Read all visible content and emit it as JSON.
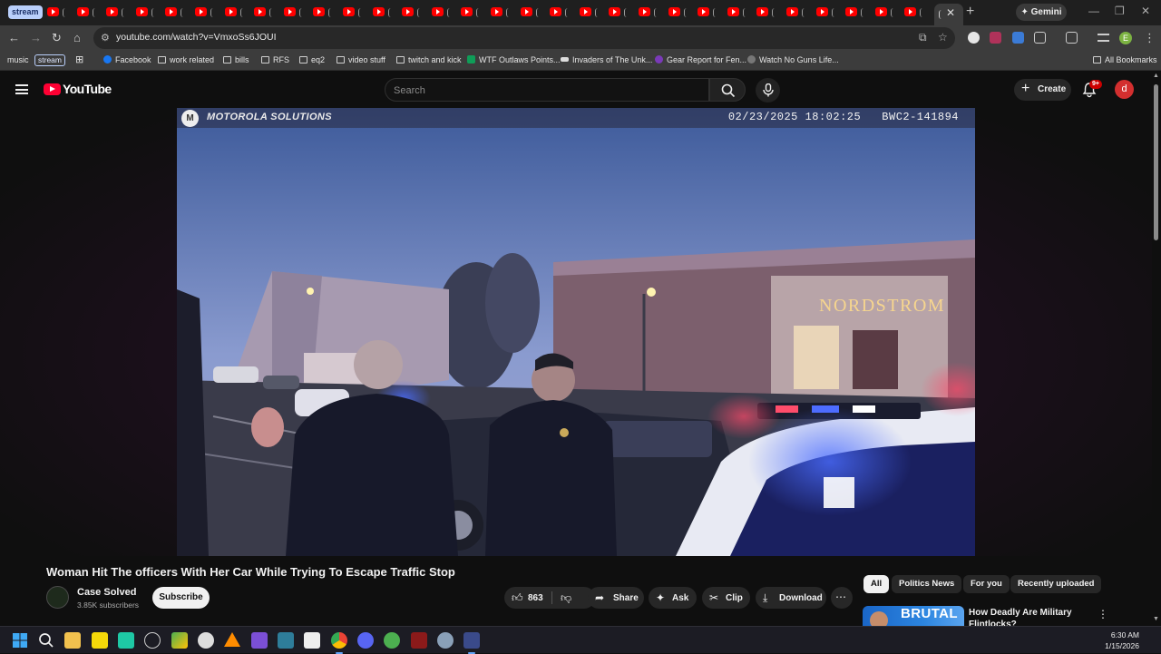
{
  "browser": {
    "stream_chip": "stream",
    "tab_count": 30,
    "gemini_label": "Gemini",
    "url": "youtube.com/watch?v=VmxoSs6JOUI",
    "profile_initial": "E",
    "bookmarks": [
      {
        "label": "music",
        "kind": "text"
      },
      {
        "label": "stream",
        "kind": "outlined"
      },
      {
        "label": "Facebook",
        "kind": "facebook"
      },
      {
        "label": "work related",
        "kind": "folder"
      },
      {
        "label": "bills",
        "kind": "folder"
      },
      {
        "label": "RFS",
        "kind": "folder"
      },
      {
        "label": "eq2",
        "kind": "folder"
      },
      {
        "label": "video stuff",
        "kind": "folder"
      },
      {
        "label": "twitch and kick",
        "kind": "folder"
      },
      {
        "label": "WTF Outlaws Points...",
        "kind": "sheets"
      },
      {
        "label": "Invaders of The Unk...",
        "kind": "site"
      },
      {
        "label": "Gear Report for Fen...",
        "kind": "site"
      },
      {
        "label": "Watch No Guns Life...",
        "kind": "site"
      }
    ],
    "all_bookmarks": "All Bookmarks"
  },
  "youtube": {
    "logo_text": "YouTube",
    "search_placeholder": "Search",
    "create_label": "Create",
    "notif_badge": "9+",
    "avatar_initial": "d"
  },
  "video": {
    "overlay_brand": "MOTOROLA SOLUTIONS",
    "overlay_timestamp": "02/23/2025 18:02:25   BWC2-141894",
    "store_sign": "NORDSTROM",
    "title": "Woman Hit The officers With Her Car While Trying To Escape Traffic Stop",
    "channel_name": "Case Solved",
    "channel_subs": "3.85K subscribers",
    "subscribe_label": "Subscribe",
    "like_count": "863",
    "share_label": "Share",
    "ask_label": "Ask",
    "clip_label": "Clip",
    "download_label": "Download"
  },
  "recommendations": {
    "chips": [
      "All",
      "Politics News",
      "For you",
      "Recently uploaded"
    ],
    "selected_chip": "All",
    "first_thumb_text": "BRUTAL",
    "first_title": "How Deadly Are Military Flintlocks?"
  },
  "taskbar": {
    "time": "6:30 AM",
    "date": "1/15/2026"
  },
  "colors": {
    "youtube_red": "#ff0033",
    "accent_blue": "#60a5fa",
    "background": "#0f0f0f"
  }
}
